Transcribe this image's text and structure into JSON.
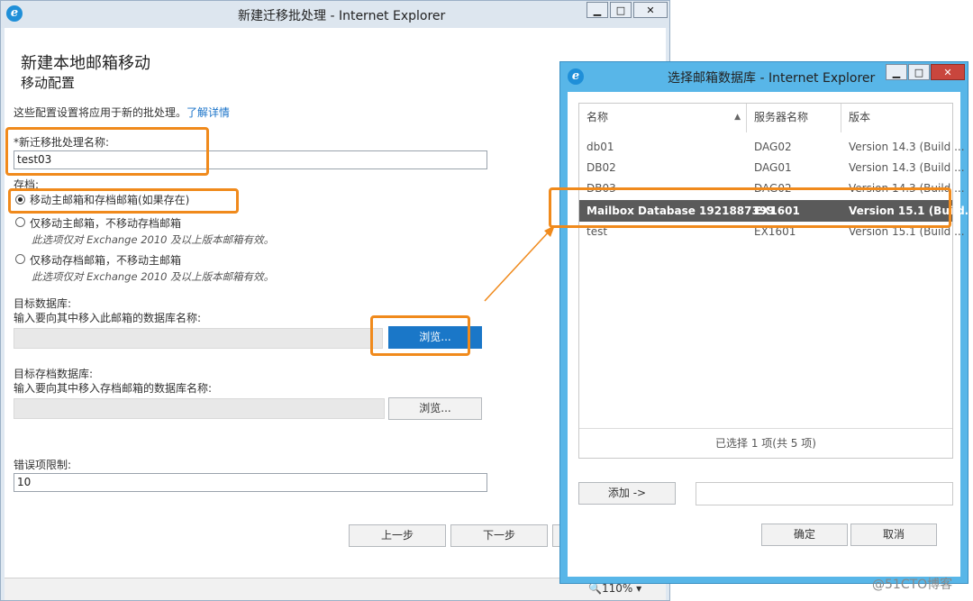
{
  "main_window": {
    "title": "新建迁移批处理 - Internet Explorer",
    "heading": "新建本地邮箱移动",
    "subheading": "移动配置",
    "intro_text": "这些配置设置将应用于新的批处理。",
    "learn_more": "了解详情",
    "batch_name_label": "*新迁移批处理名称:",
    "batch_name_value": "test03",
    "archive_label": "存档:",
    "archive_options": [
      {
        "label": "移动主邮箱和存档邮箱(如果存在)",
        "note": "",
        "selected": true
      },
      {
        "label": "仅移动主邮箱，不移动存档邮箱",
        "note": "此选项仅对 Exchange 2010 及以上版本邮箱有效。",
        "selected": false
      },
      {
        "label": "仅移动存档邮箱，不移动主邮箱",
        "note": "此选项仅对 Exchange 2010 及以上版本邮箱有效。",
        "selected": false
      }
    ],
    "target_db_label": "目标数据库:",
    "target_db_hint": "输入要向其中移入此邮箱的数据库名称:",
    "browse_label": "浏览...",
    "target_archive_db_label": "目标存档数据库:",
    "target_archive_db_hint": "输入要向其中移入存档邮箱的数据库名称:",
    "error_limit_label": "错误项限制:",
    "error_limit_value": "10",
    "back_button": "上一步",
    "next_button": "下一步",
    "zoom": "110%"
  },
  "dialog": {
    "title": "选择邮箱数据库 - Internet Explorer",
    "columns": [
      "名称",
      "服务器名称",
      "版本"
    ],
    "rows": [
      {
        "name": "db01",
        "server": "DAG02",
        "version": "Version 14.3 (Build ..."
      },
      {
        "name": "DB02",
        "server": "DAG01",
        "version": "Version 14.3 (Build ..."
      },
      {
        "name": "DB03",
        "server": "DAG02",
        "version": "Version 14.3 (Build ..."
      },
      {
        "name": "Mailbox Database 1921887399",
        "server": "EX1601",
        "version": "Version 15.1 (Build..."
      },
      {
        "name": "test",
        "server": "EX1601",
        "version": "Version 15.1 (Build ..."
      }
    ],
    "selected_index": 3,
    "status": "已选择 1 项(共 5 项)",
    "add_button": "添加 ->",
    "ok_button": "确定",
    "cancel_button": "取消"
  },
  "watermark": "@51CTO博客",
  "colors": {
    "highlight": "#f08a1c",
    "primary": "#1a77c8",
    "dialog_frame": "#58b6e8"
  }
}
